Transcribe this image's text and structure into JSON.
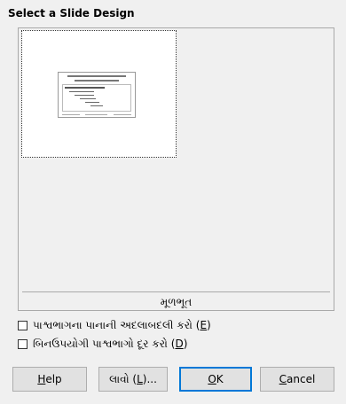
{
  "dialog": {
    "heading": "Select a Slide Design",
    "design_caption": "મૂળભૂત",
    "options": [
      {
        "label": "પાશ્વભાગના પાનાની અદલાબદલી કરો (",
        "mnemonic": "E",
        "suffix": ")",
        "checked": false
      },
      {
        "label": "બિનઉપયોગી પાશ્વભાગો દૂર કરો (",
        "mnemonic": "D",
        "suffix": ")",
        "checked": false
      }
    ],
    "buttons": {
      "help": {
        "mnemonic": "H",
        "rest": "elp"
      },
      "load": {
        "before": "લાવો (",
        "mnemonic": "L",
        "after": ")..."
      },
      "ok": {
        "mnemonic": "O",
        "rest": "K"
      },
      "cancel": {
        "mnemonic": "C",
        "rest": "ancel"
      }
    }
  }
}
